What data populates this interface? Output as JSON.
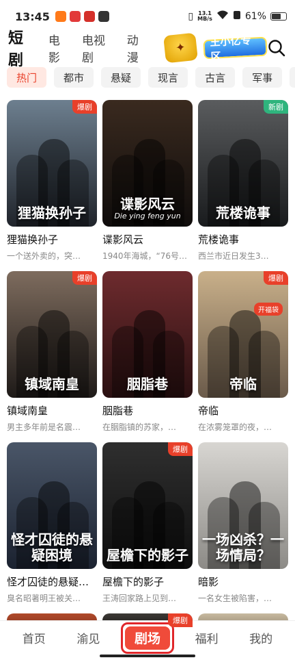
{
  "status_bar": {
    "time": "13:45",
    "net_speed": "13.1",
    "net_unit": "MB/s",
    "battery": "61%"
  },
  "header": {
    "tabs": [
      {
        "label": "短剧",
        "active": true
      },
      {
        "label": "电影",
        "active": false
      },
      {
        "label": "电视剧",
        "active": false
      },
      {
        "label": "动漫",
        "active": false
      }
    ],
    "zone_badge": "王小亿专区",
    "search_icon": "search-icon"
  },
  "categories": [
    {
      "label": "热门",
      "active": true
    },
    {
      "label": "都市",
      "active": false
    },
    {
      "label": "悬疑",
      "active": false
    },
    {
      "label": "现言",
      "active": false
    },
    {
      "label": "古言",
      "active": false
    },
    {
      "label": "军事",
      "active": false
    },
    {
      "label": "玄幻",
      "active": false
    }
  ],
  "dramas": [
    {
      "title": "狸猫换孙子",
      "desc": "一个送外卖的，突…",
      "badge": "爆剧",
      "poster_text": "狸猫换孙子",
      "poster_sub": "",
      "colors": [
        "#6d7f8f",
        "#20242b"
      ]
    },
    {
      "title": "谍影风云",
      "desc": "1940年海城，“76号…",
      "badge": "",
      "poster_text": "谍影风云",
      "poster_sub": "Die ying feng yun",
      "colors": [
        "#3a2a1f",
        "#0f0c0b"
      ]
    },
    {
      "title": "荒楼诡事",
      "desc": "西兰市近日发生3…",
      "badge": "新剧",
      "poster_text": "荒楼诡事",
      "poster_sub": "",
      "colors": [
        "#5a5c5e",
        "#191b1d"
      ]
    },
    {
      "title": "镇域南皇",
      "desc": "男主多年前是名震…",
      "badge": "爆剧",
      "poster_text": "镇域南皇",
      "poster_sub": "",
      "colors": [
        "#7e6c5e",
        "#1e1a18"
      ]
    },
    {
      "title": "胭脂巷",
      "desc": "在胭脂镇的苏家，…",
      "badge": "",
      "poster_text": "胭脂巷",
      "poster_sub": "",
      "colors": [
        "#6e2b2e",
        "#2a1011"
      ]
    },
    {
      "title": "帝临",
      "desc": "在浓雾笼罩的夜，…",
      "badge": "爆剧",
      "poster_text": "帝临",
      "poster_sub": "",
      "lucky_bag": "开福袋",
      "colors": [
        "#c9b08a",
        "#6a5a4a"
      ]
    },
    {
      "title": "怪才囚徒的悬疑…",
      "desc": "臭名昭著明王被关…",
      "badge": "",
      "poster_text": "怪才囚徒的悬疑困境",
      "poster_sub": "",
      "colors": [
        "#4a5668",
        "#1b2230"
      ]
    },
    {
      "title": "屋檐下的影子",
      "desc": "王涛回家路上见到…",
      "badge": "爆剧",
      "poster_text": "屋檐下的影子",
      "poster_sub": "",
      "colors": [
        "#2f2f2f",
        "#0e0e0e"
      ]
    },
    {
      "title": "暗影",
      "desc": "一名女生被陷害，…",
      "badge": "",
      "poster_text": "一场凶杀？一场情局？",
      "poster_sub": "",
      "colors": [
        "#d8d6d2",
        "#8c8a86"
      ]
    }
  ],
  "peek_row": [
    {
      "badge": "",
      "colors": [
        "#b04a2a",
        "#8a3520"
      ]
    },
    {
      "badge": "爆剧",
      "colors": [
        "#3d3a36",
        "#1e1c1a"
      ]
    },
    {
      "badge": "",
      "colors": [
        "#c7b9a0",
        "#9a8d76"
      ]
    }
  ],
  "tabbar": [
    {
      "label": "首页",
      "active": false
    },
    {
      "label": "渝见",
      "active": false
    },
    {
      "label": "剧场",
      "active": true
    },
    {
      "label": "福利",
      "active": false
    },
    {
      "label": "我的",
      "active": false
    }
  ]
}
